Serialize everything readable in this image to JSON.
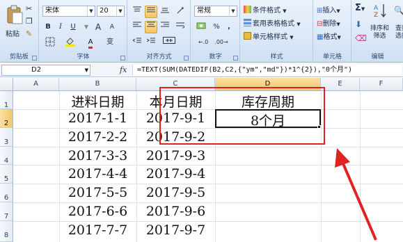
{
  "ribbon": {
    "clipboard": {
      "paste_label": "粘贴",
      "group_label": "剪贴板"
    },
    "font": {
      "font_name": "宋体",
      "font_size": "20",
      "bold": "B",
      "italic": "I",
      "underline": "U",
      "grow_font": "A",
      "shrink_font": "A",
      "font_color_letter": "A",
      "phonetic": "变",
      "group_label": "字体"
    },
    "alignment": {
      "group_label": "对齐方式"
    },
    "number": {
      "format": "常规",
      "percent": "%",
      "comma": ",",
      "group_label": "数字"
    },
    "styles": {
      "conditional_format": "条件格式",
      "table_format": "套用表格格式",
      "cell_styles": "单元格样式",
      "group_label": "样式"
    },
    "cells": {
      "insert": "插入",
      "delete": "删除",
      "format": "格式",
      "group_label": "单元格"
    },
    "editing": {
      "sum_symbol": "Σ",
      "sort_filter_line1": "排序和",
      "sort_filter_line2": "筛选",
      "find_line1": "查找",
      "find_line2": "选择",
      "group_label": "编辑"
    }
  },
  "formula_bar": {
    "name_box": "D2",
    "fx": "fx",
    "formula": "=TEXT(SUM(DATEDIF(B2,C2,{\"ym\",\"md\"})*1^{2}),\"0个月\")"
  },
  "columns": [
    "A",
    "B",
    "C",
    "D",
    "E",
    "F"
  ],
  "rows": [
    "1",
    "2",
    "3",
    "4",
    "5",
    "6",
    "7",
    "8"
  ],
  "headers": {
    "purchase_date": "进料日期",
    "current_date": "本月日期",
    "inventory_period": "库存周期"
  },
  "table": [
    {
      "purchase": "2017-1-1",
      "current": "2017-9-1",
      "period": "8个月"
    },
    {
      "purchase": "2017-2-2",
      "current": "2017-9-2",
      "period": ""
    },
    {
      "purchase": "2017-3-3",
      "current": "2017-9-3",
      "period": ""
    },
    {
      "purchase": "2017-4-4",
      "current": "2017-9-4",
      "period": ""
    },
    {
      "purchase": "2017-5-5",
      "current": "2017-9-5",
      "period": ""
    },
    {
      "purchase": "2017-6-6",
      "current": "2017-9-6",
      "period": ""
    },
    {
      "purchase": "2017-7-7",
      "current": "2017-9-7",
      "period": ""
    }
  ],
  "colors": {
    "highlight_box": "#e02222",
    "arrow": "#e02222",
    "active_header": "#f6c566"
  }
}
